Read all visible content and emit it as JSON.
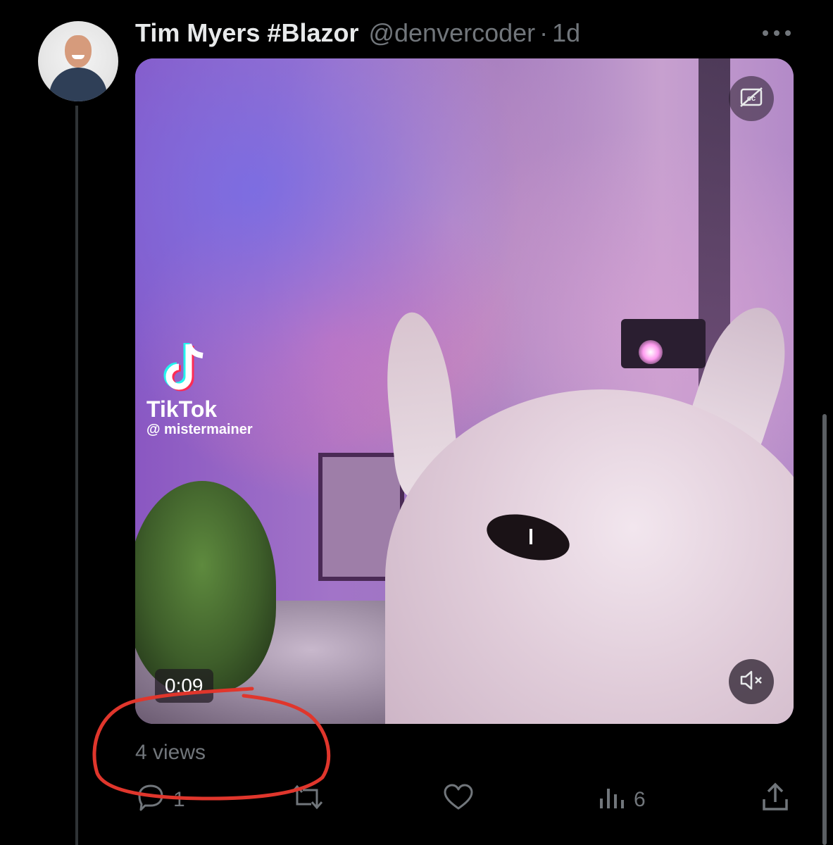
{
  "tweet": {
    "display_name": "Tim Myers #Blazor",
    "handle": "@denvercoder",
    "separator": "·",
    "time": "1d"
  },
  "media": {
    "watermark_brand": "TikTok",
    "watermark_user": "@ mistermainer",
    "timestamp": "0:09"
  },
  "views": "4 views",
  "actions": {
    "reply_count": "1",
    "retweet_count": "",
    "like_count": "",
    "analytics_count": "6"
  },
  "icons": {
    "more": "more-horizontal-icon",
    "cc": "closed-captions-off-icon",
    "mute": "volume-muted-icon",
    "reply": "reply-icon",
    "retweet": "retweet-icon",
    "like": "heart-icon",
    "analytics": "analytics-icon",
    "share": "share-icon"
  },
  "colors": {
    "background": "#000000",
    "text_primary": "#e7e9ea",
    "text_secondary": "#71767b",
    "annotation": "#e0362c"
  }
}
